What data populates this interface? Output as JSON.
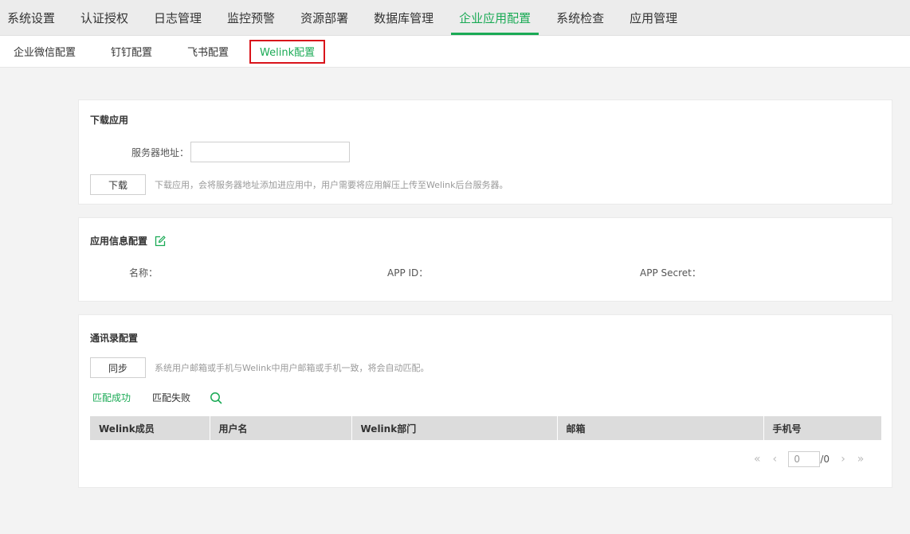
{
  "topnav": {
    "tabs": [
      "系统设置",
      "认证授权",
      "日志管理",
      "监控预警",
      "资源部署",
      "数据库管理",
      "企业应用配置",
      "系统检查",
      "应用管理"
    ],
    "active": "企业应用配置"
  },
  "subnav": {
    "tabs": [
      "企业微信配置",
      "钉钉配置",
      "飞书配置",
      "Welink配置"
    ],
    "active": "Welink配置"
  },
  "download": {
    "title": "下载应用",
    "server_label": "服务器地址：",
    "server_value": "",
    "button": "下载",
    "hint": "下载应用，会将服务器地址添加进应用中，用户需要将应用解压上传至Welink后台服务器。"
  },
  "app_info": {
    "title": "应用信息配置",
    "name_label": "名称：",
    "appid_label": "APP ID：",
    "secret_label": "APP Secret："
  },
  "contacts": {
    "title": "通讯录配置",
    "sync_button": "同步",
    "hint": "系统用户邮箱或手机与Welink中用户邮箱或手机一致，将会自动匹配。",
    "filter_ok": "匹配成功",
    "filter_fail": "匹配失败",
    "columns": [
      "Welink成员",
      "用户名",
      "Welink部门",
      "邮箱",
      "手机号"
    ],
    "pager": {
      "current": "0",
      "total": "/0"
    }
  },
  "colors": {
    "accent": "#1aaa55",
    "highlight_border": "#d9141b"
  },
  "icons": {
    "edit": "edit-icon",
    "search": "search-icon"
  }
}
